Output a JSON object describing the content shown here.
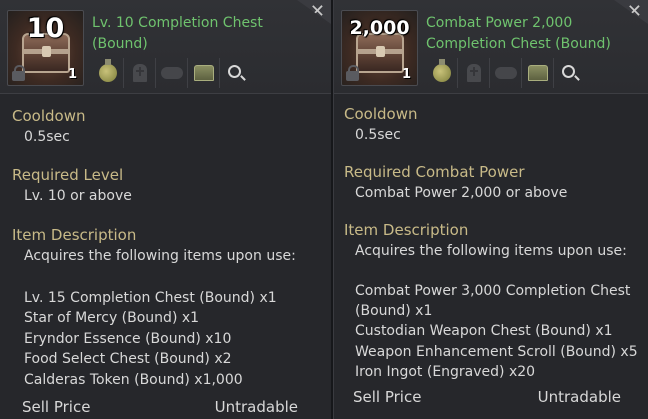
{
  "tooltips": [
    {
      "thumb_number": "10",
      "stack_count": "1",
      "name": "Lv. 10 Completion Chest (Bound)",
      "close_glyph": "✕",
      "cooldown_label": "Cooldown",
      "cooldown_value": "0.5sec",
      "requirement_label": "Required Level",
      "requirement_value": "Lv. 10 or above",
      "description_label": "Item Description",
      "description_intro": "Acquires the following items upon use:",
      "contents": [
        "Lv. 15 Completion Chest (Bound) x1",
        "Star of Mercy (Bound) x1",
        "Eryndor Essence (Bound) x10",
        "Food Select Chest (Bound) x2",
        "Calderas Token (Bound) x1,000"
      ],
      "sell_label": "Sell Price",
      "sell_value": "Untradable"
    },
    {
      "thumb_number": "2,000",
      "stack_count": "1",
      "name": "Combat Power 2,000 Completion Chest (Bound)",
      "close_glyph": "✕",
      "cooldown_label": "Cooldown",
      "cooldown_value": "0.5sec",
      "requirement_label": "Required Combat Power",
      "requirement_value": "Combat Power 2,000 or above",
      "description_label": "Item Description",
      "description_intro": "Acquires the following items upon use:",
      "contents": [
        "Combat Power 3,000 Completion Chest",
        "(Bound) x1",
        "Custodian Weapon Chest (Bound) x1",
        "Weapon Enhancement Scroll (Bound) x5",
        "Iron Ingot (Engraved) x20"
      ],
      "sell_label": "Sell Price",
      "sell_value": "Untradable"
    }
  ],
  "action_icons": [
    "potion-icon",
    "grave-icon",
    "handshake-icon",
    "chest-icon",
    "search-icon"
  ],
  "colors": {
    "item_name": "#6fc36e",
    "section_label": "#c8ba88",
    "text": "#d8d8d8",
    "panel_bg": "#26272b"
  }
}
